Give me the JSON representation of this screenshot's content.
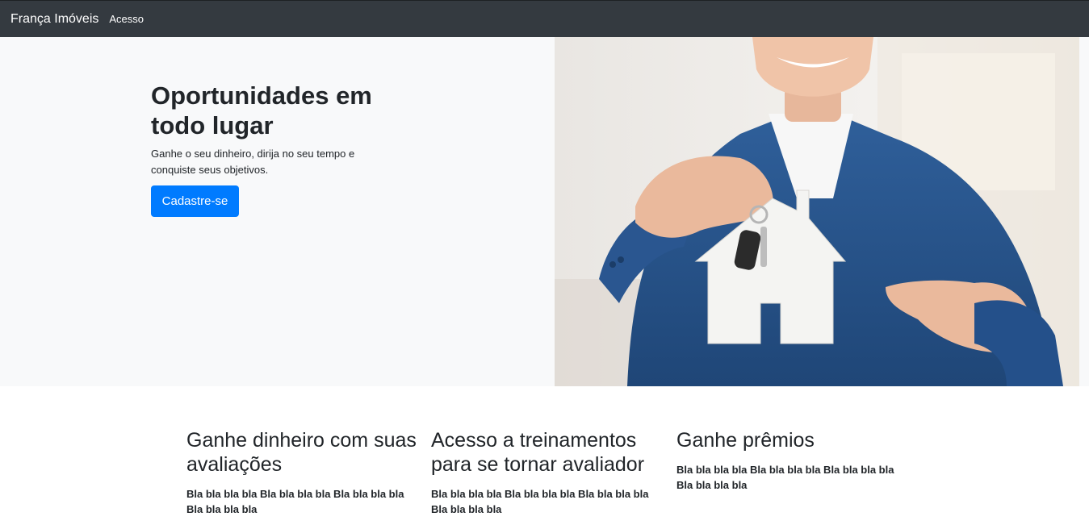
{
  "navbar": {
    "brand": "França Imóveis",
    "links": [
      "Acesso"
    ]
  },
  "hero": {
    "title": "Oportunidades em todo lugar",
    "subtitle": "Ganhe o seu dinheiro, dirija no seu tempo e conquiste seus objetivos.",
    "cta_label": "Cadastre-se"
  },
  "features": [
    {
      "title": "Ganhe dinheiro com suas avaliações",
      "text": "Bla bla bla bla Bla bla bla bla Bla bla bla bla Bla bla bla bla"
    },
    {
      "title": "Acesso a treinamentos para se tornar avaliador",
      "text": "Bla bla bla bla Bla bla bla bla Bla bla bla bla Bla bla bla bla"
    },
    {
      "title": "Ganhe prêmios",
      "text": "Bla bla bla bla Bla bla bla bla Bla bla bla bla Bla bla bla bla"
    }
  ],
  "colors": {
    "navbar_bg": "#343a40",
    "hero_bg": "#f8f9fa",
    "primary": "#007bff"
  }
}
